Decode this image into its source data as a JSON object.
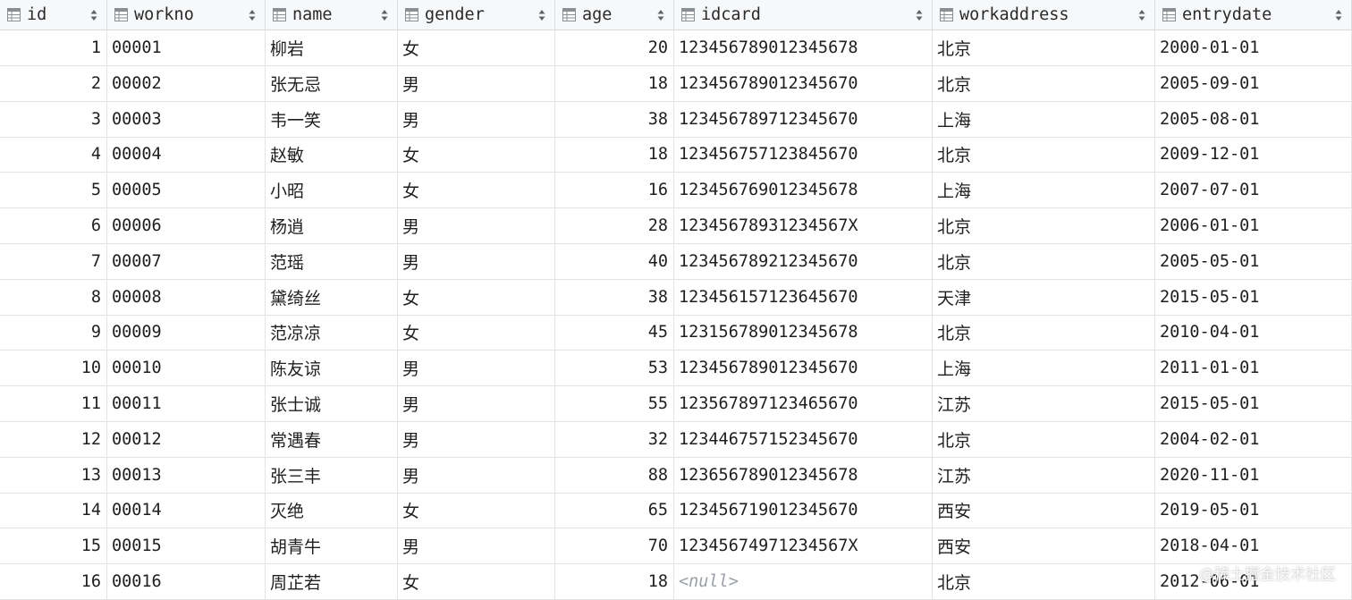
{
  "table": {
    "columns": [
      {
        "key": "id",
        "label": "id"
      },
      {
        "key": "workno",
        "label": "workno"
      },
      {
        "key": "name",
        "label": "name"
      },
      {
        "key": "gender",
        "label": "gender"
      },
      {
        "key": "age",
        "label": "age"
      },
      {
        "key": "idcard",
        "label": "idcard"
      },
      {
        "key": "workaddress",
        "label": "workaddress"
      },
      {
        "key": "entrydate",
        "label": "entrydate"
      }
    ],
    "header_icon": "table-column-icon",
    "sort_icon": "sort-arrows-icon",
    "rows": [
      {
        "id": "1",
        "workno": "00001",
        "name": "柳岩",
        "gender": "女",
        "age": "20",
        "idcard": "123456789012345678",
        "workaddress": "北京",
        "entrydate": "2000-01-01"
      },
      {
        "id": "2",
        "workno": "00002",
        "name": "张无忌",
        "gender": "男",
        "age": "18",
        "idcard": "123456789012345670",
        "workaddress": "北京",
        "entrydate": "2005-09-01"
      },
      {
        "id": "3",
        "workno": "00003",
        "name": "韦一笑",
        "gender": "男",
        "age": "38",
        "idcard": "123456789712345670",
        "workaddress": "上海",
        "entrydate": "2005-08-01"
      },
      {
        "id": "4",
        "workno": "00004",
        "name": "赵敏",
        "gender": "女",
        "age": "18",
        "idcard": "123456757123845670",
        "workaddress": "北京",
        "entrydate": "2009-12-01"
      },
      {
        "id": "5",
        "workno": "00005",
        "name": "小昭",
        "gender": "女",
        "age": "16",
        "idcard": "123456769012345678",
        "workaddress": "上海",
        "entrydate": "2007-07-01"
      },
      {
        "id": "6",
        "workno": "00006",
        "name": "杨逍",
        "gender": "男",
        "age": "28",
        "idcard": "12345678931234567X",
        "workaddress": "北京",
        "entrydate": "2006-01-01"
      },
      {
        "id": "7",
        "workno": "00007",
        "name": "范瑶",
        "gender": "男",
        "age": "40",
        "idcard": "123456789212345670",
        "workaddress": "北京",
        "entrydate": "2005-05-01"
      },
      {
        "id": "8",
        "workno": "00008",
        "name": "黛绮丝",
        "gender": "女",
        "age": "38",
        "idcard": "123456157123645670",
        "workaddress": "天津",
        "entrydate": "2015-05-01"
      },
      {
        "id": "9",
        "workno": "00009",
        "name": "范凉凉",
        "gender": "女",
        "age": "45",
        "idcard": "123156789012345678",
        "workaddress": "北京",
        "entrydate": "2010-04-01"
      },
      {
        "id": "10",
        "workno": "00010",
        "name": "陈友谅",
        "gender": "男",
        "age": "53",
        "idcard": "123456789012345670",
        "workaddress": "上海",
        "entrydate": "2011-01-01"
      },
      {
        "id": "11",
        "workno": "00011",
        "name": "张士诚",
        "gender": "男",
        "age": "55",
        "idcard": "123567897123465670",
        "workaddress": "江苏",
        "entrydate": "2015-05-01"
      },
      {
        "id": "12",
        "workno": "00012",
        "name": "常遇春",
        "gender": "男",
        "age": "32",
        "idcard": "123446757152345670",
        "workaddress": "北京",
        "entrydate": "2004-02-01"
      },
      {
        "id": "13",
        "workno": "00013",
        "name": "张三丰",
        "gender": "男",
        "age": "88",
        "idcard": "123656789012345678",
        "workaddress": "江苏",
        "entrydate": "2020-11-01"
      },
      {
        "id": "14",
        "workno": "00014",
        "name": "灭绝",
        "gender": "女",
        "age": "65",
        "idcard": "123456719012345670",
        "workaddress": "西安",
        "entrydate": "2019-05-01"
      },
      {
        "id": "15",
        "workno": "00015",
        "name": "胡青牛",
        "gender": "男",
        "age": "70",
        "idcard": "12345674971234567X",
        "workaddress": "西安",
        "entrydate": "2018-04-01"
      },
      {
        "id": "16",
        "workno": "00016",
        "name": "周芷若",
        "gender": "女",
        "age": "18",
        "idcard": "<null>",
        "workaddress": "北京",
        "entrydate": "2012-06-01"
      }
    ]
  },
  "watermark": "@稀土掘金技术社区"
}
